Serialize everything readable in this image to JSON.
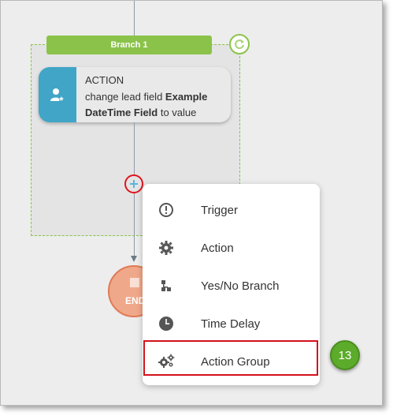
{
  "branch": {
    "label": "Branch 1",
    "sync_icon": "refresh-icon"
  },
  "action_card": {
    "icon": "user-star-icon",
    "title": "ACTION",
    "desc_pre": "change lead field ",
    "desc_bold": "Example DateTime Field",
    "desc_post": " to value"
  },
  "end_node": {
    "label": "END"
  },
  "menu": {
    "items": [
      {
        "label": "Trigger",
        "icon": "alert-circle-icon"
      },
      {
        "label": "Action",
        "icon": "gear-icon"
      },
      {
        "label": "Yes/No Branch",
        "icon": "branch-icon"
      },
      {
        "label": "Time Delay",
        "icon": "clock-icon"
      },
      {
        "label": "Action Group",
        "icon": "gears-icon"
      }
    ]
  },
  "step_badge": "13",
  "colors": {
    "branch_green": "#8bc34a",
    "action_blue": "#40a5c6",
    "end_orange": "#f0a88a",
    "highlight_red": "#d3121a",
    "badge_green": "#5cab2b"
  }
}
